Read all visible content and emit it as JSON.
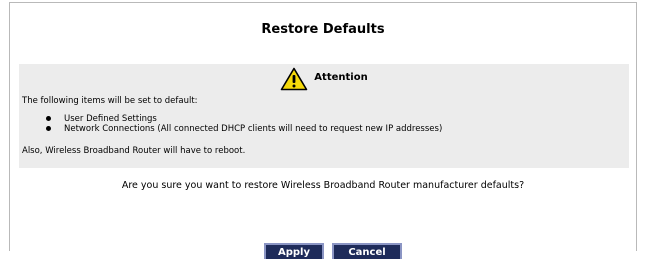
{
  "dialog": {
    "title": "Restore Defaults",
    "attention_label": "Attention",
    "intro": "The following items will be set to default:",
    "items": [
      "User Defined Settings",
      "Network Connections (All connected DHCP clients will need to request new IP addresses)"
    ],
    "outro": "Also, Wireless Broadband Router will have to reboot.",
    "question": "Are you sure you want to restore Wireless Broadband Router manufacturer defaults?",
    "apply_label": "Apply",
    "cancel_label": "Cancel"
  },
  "colors": {
    "panel_bg": "#ececec",
    "button_bg": "#1e2b5a",
    "button_border": "#8b95c4",
    "warning_yellow": "#f5d90a"
  },
  "icons": {
    "attention": "warning-triangle-icon",
    "bullet": "bullet-icon"
  }
}
